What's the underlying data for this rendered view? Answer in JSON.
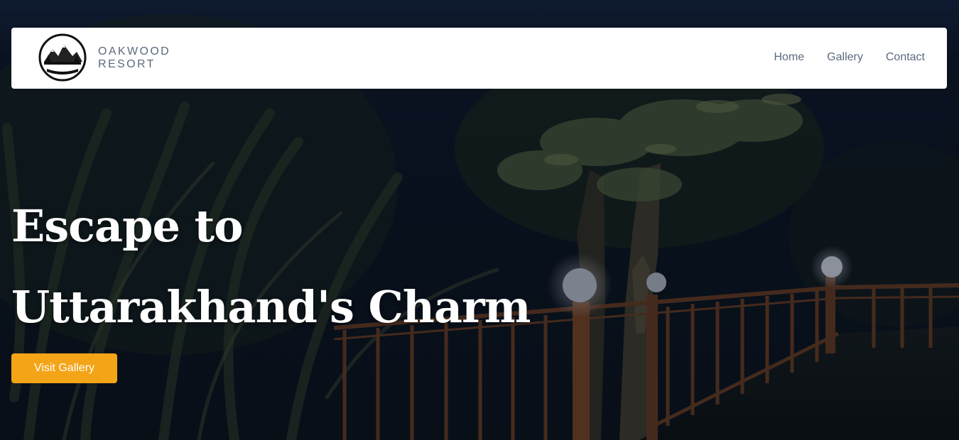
{
  "brand": {
    "logo_text": "OAK WOOD RESORT",
    "name_line1": "OAKWOOD",
    "name_line2": "RESORT"
  },
  "nav": {
    "items": [
      {
        "label": "Home"
      },
      {
        "label": "Gallery"
      },
      {
        "label": "Contact"
      }
    ]
  },
  "hero": {
    "headline_line1": "Escape to",
    "headline_line2": "Uttarakhand's Charm",
    "cta_label": "Visit Gallery"
  },
  "colors": {
    "accent": "#f4a417",
    "nav_text": "#5b6b7f",
    "hero_bg": "#0a1220"
  }
}
